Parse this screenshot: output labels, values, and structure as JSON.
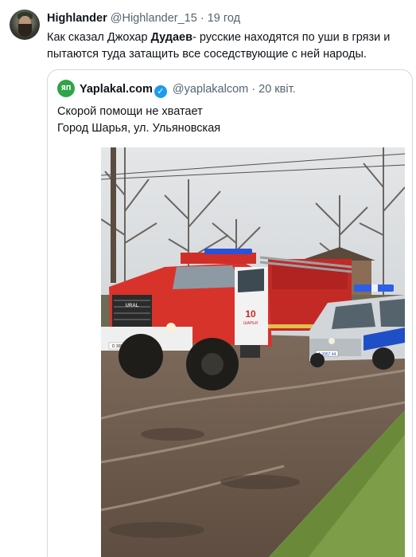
{
  "tweet": {
    "author_name": "Highlander",
    "author_handle": "@Highlander_15",
    "separator": "·",
    "time": "19 год",
    "text_before": "Как сказал Джохар ",
    "text_bold": "Дудаев",
    "text_after": "- русские находятся по уши в грязи и пытаются туда затащить все соседствующие с ней народы."
  },
  "quote": {
    "author_name": "Yaplakal.com",
    "author_handle": "@yaplakalcom",
    "separator": "·",
    "time": "20 квіт.",
    "avatar_text": "ЯП",
    "line1": "Скорой помощи не хватает",
    "line2": "Город Шарья, ул. Ульяновская",
    "photo": {
      "truck_number": "10",
      "truck_city": "ШАРЬЯ",
      "truck_brand": "URAL",
      "truck_plate": "О 305 ОО",
      "car_plate": "А 3957 44"
    }
  },
  "colors": {
    "text": "#0f1419",
    "secondary": "#536471",
    "verified": "#1d9bf0",
    "border": "#cfd9de",
    "yaplakal_green": "#2fa547"
  }
}
